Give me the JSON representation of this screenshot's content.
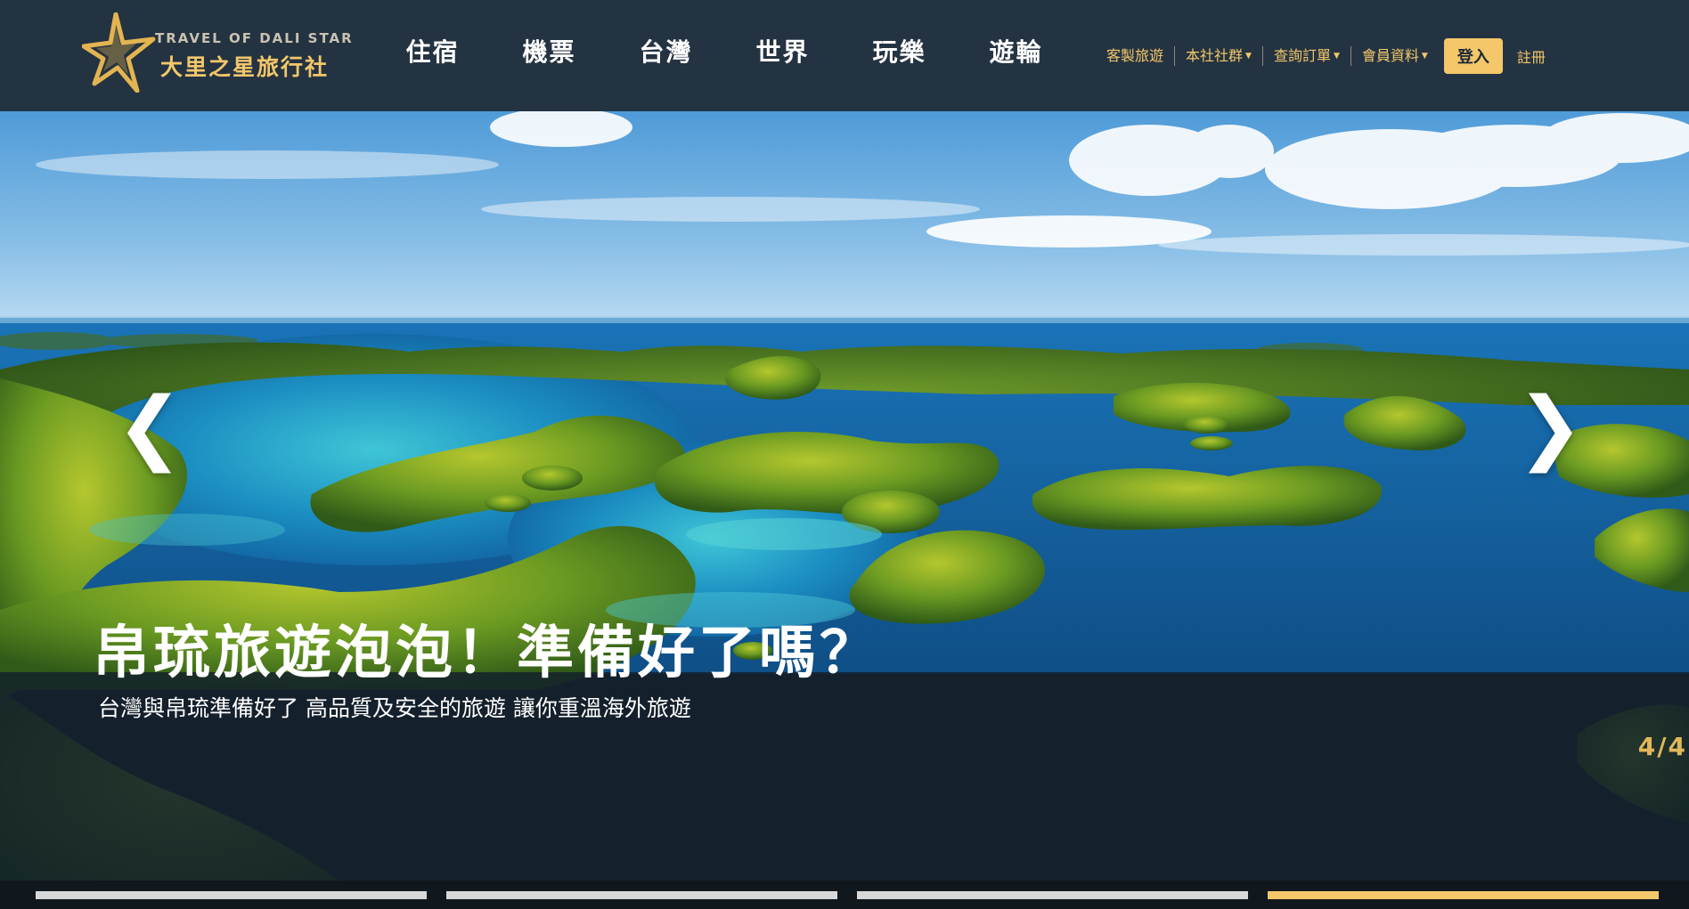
{
  "brand": {
    "name_en": "TRAVEL OF DALI STAR",
    "name_zh": "大里之星旅行社",
    "colors": {
      "header_bg": "#243341",
      "accent": "#f3c76a",
      "caption_bg": "#14202c"
    }
  },
  "main_nav": [
    {
      "label": "住宿"
    },
    {
      "label": "機票"
    },
    {
      "label": "台灣"
    },
    {
      "label": "世界"
    },
    {
      "label": "玩樂"
    },
    {
      "label": "遊輪"
    }
  ],
  "util_nav": {
    "custom_tour": "客製旅遊",
    "community": "本社社群",
    "orders": "查詢訂單",
    "member": "會員資料",
    "login": "登入",
    "register": "註冊",
    "dropdown_icon": "caret-down-icon"
  },
  "hero": {
    "title": "帛琉旅遊泡泡！準備好了嗎？",
    "subtitle": "台灣與帛琉準備好了 高品質及安全的旅遊 讓你重溫海外旅遊",
    "counter": "4/4",
    "current_slide": 4,
    "total_slides": 4,
    "prev_glyph": "❮",
    "next_glyph": "❯",
    "prev_icon": "chevron-left-icon",
    "next_icon": "chevron-right-icon"
  }
}
